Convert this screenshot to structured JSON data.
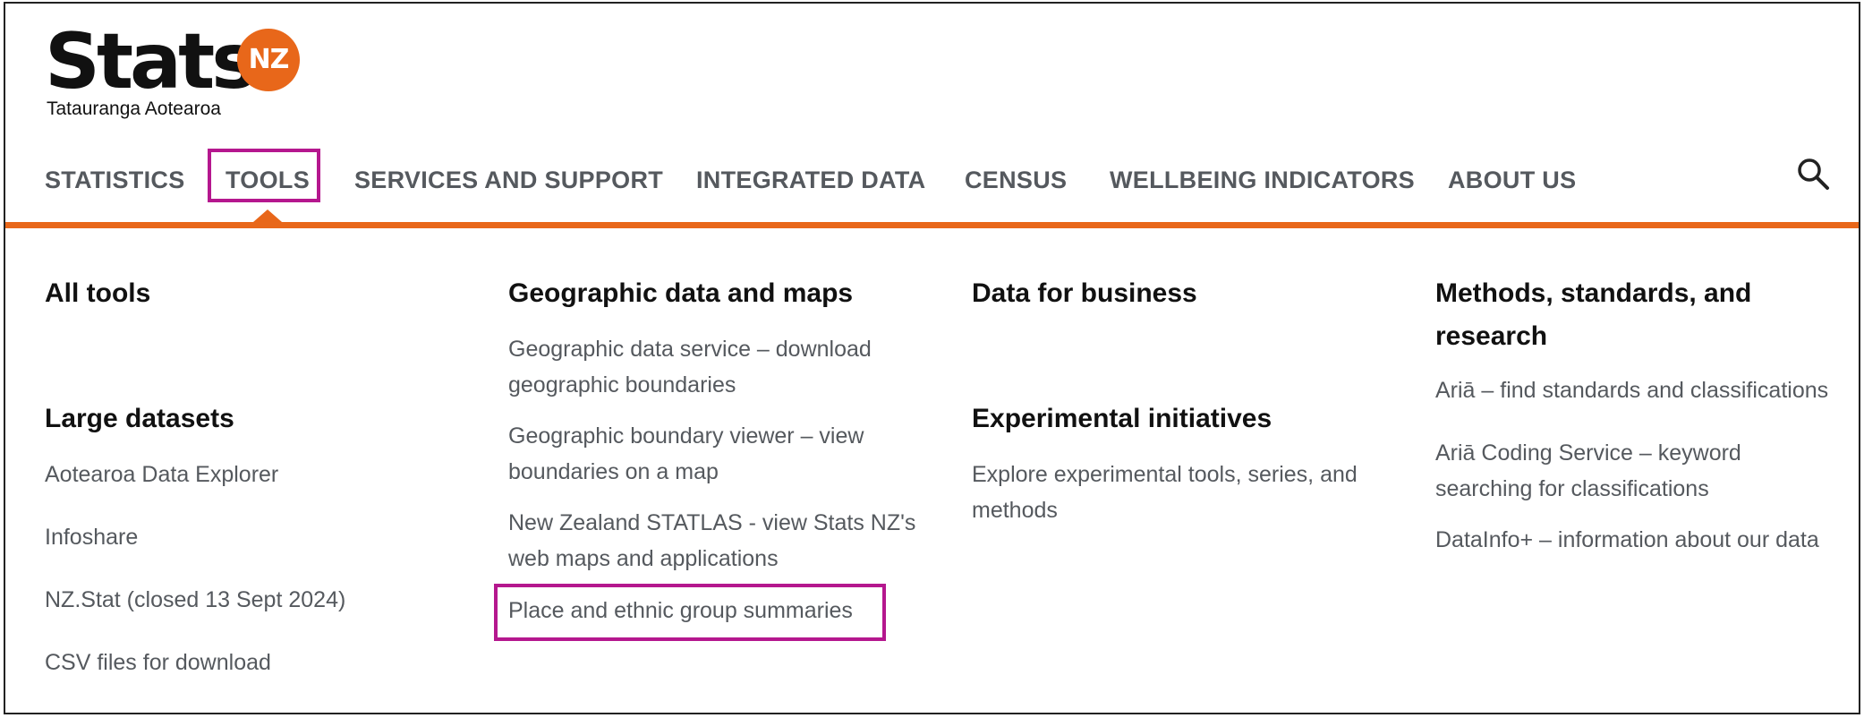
{
  "logo": {
    "wordmark": "Stats",
    "badge": "NZ",
    "tagline": "Tatauranga Aotearoa",
    "accent_color": "#e8671a"
  },
  "nav": {
    "items": [
      "STATISTICS",
      "TOOLS",
      "SERVICES AND SUPPORT",
      "INTEGRATED DATA",
      "CENSUS",
      "WELLBEING INDICATORS",
      "ABOUT US"
    ],
    "active": "TOOLS",
    "search_icon": "search-icon"
  },
  "highlight_color": "#b5178e",
  "menu": {
    "col1": {
      "all_tools": "All tools",
      "large_datasets": {
        "heading": "Large datasets",
        "links": [
          "Aotearoa Data Explorer",
          "Infoshare",
          "NZ.Stat (closed 13 Sept 2024)",
          "CSV files for download"
        ]
      }
    },
    "col2": {
      "heading": "Geographic data and maps",
      "links": [
        "Geographic data service – download geographic boundaries",
        "Geographic boundary viewer – view boundaries on a map",
        "New Zealand STATLAS - view Stats NZ's web maps and applications",
        "Place and ethnic group summaries"
      ]
    },
    "col3": {
      "heading": "Data for business",
      "experimental": {
        "heading": "Experimental initiatives",
        "links": [
          "Explore experimental tools, series, and methods"
        ]
      }
    },
    "col4": {
      "heading": "Methods, standards, and research",
      "links": [
        "Ariā – find standards and classifications",
        "Ariā Coding Service – keyword searching for classifications",
        "DataInfo+ – information about our data"
      ]
    }
  }
}
